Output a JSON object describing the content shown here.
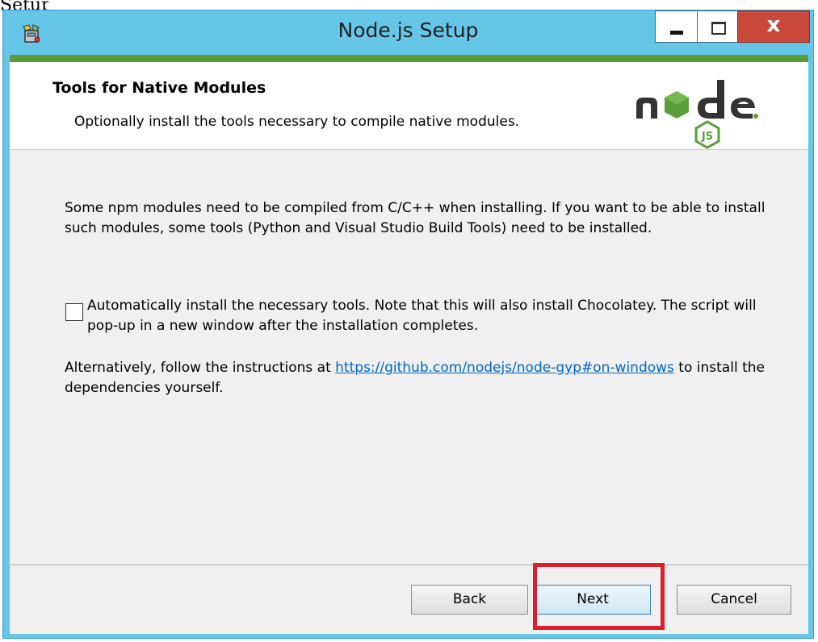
{
  "window": {
    "title": "Node.js Setup",
    "close_glyph": "x",
    "title_bar_color": "#65c6e8",
    "close_color": "#c9483c"
  },
  "banner": {
    "title": "Tools for Native Modules",
    "subtitle": "Optionally install the tools necessary to compile native modules.",
    "logo": "node-js-logo",
    "accent": "#5a9e3a"
  },
  "content": {
    "intro": "Some npm modules need to be compiled from C/C++ when installing. If you want to be able to install such modules, some tools (Python and Visual Studio Build Tools) need to be installed.",
    "checkbox": {
      "label": "Automatically install the necessary tools. Note that this will also install Chocolatey. The script will pop-up in a new window after the installation completes.",
      "checked": false
    },
    "alternative_prefix": "Alternatively, follow the instructions at ",
    "alternative_link": "https://github.com/nodejs/node-gyp#on-windows",
    "alternative_suffix": " to install the dependencies yourself."
  },
  "buttons": {
    "back": "Back",
    "next": "Next",
    "cancel": "Cancel"
  },
  "annotation": {
    "highlight_target": "next-button",
    "highlight_color": "#e01e2b"
  }
}
